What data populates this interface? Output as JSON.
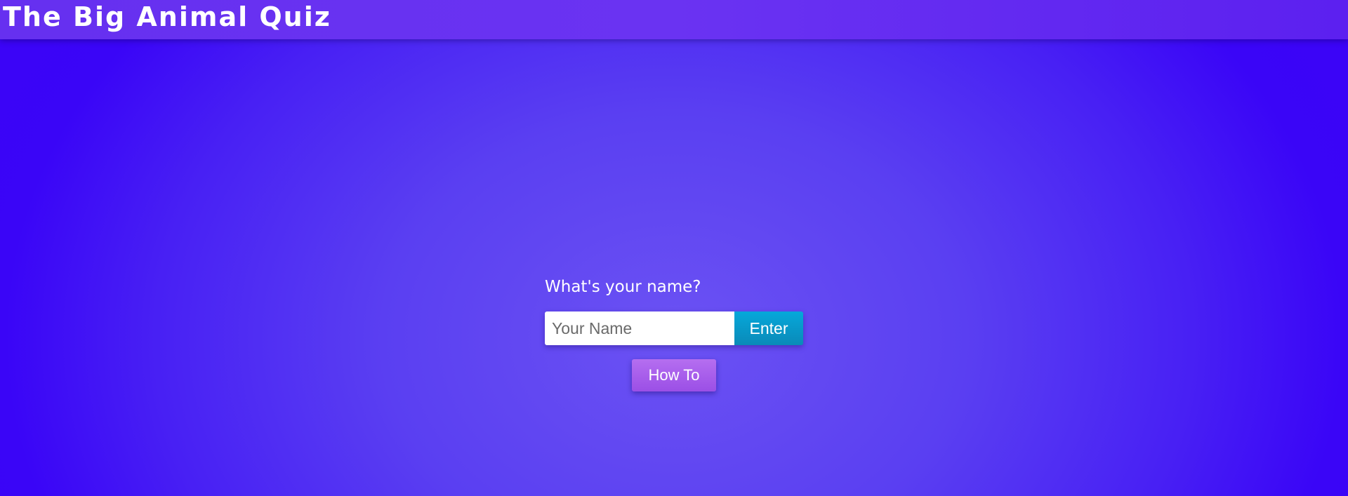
{
  "app": {
    "title": "The Big Animal Quiz"
  },
  "name_form": {
    "prompt": "What's your name?",
    "input_placeholder": "Your Name",
    "input_value": "",
    "enter_label": "Enter"
  },
  "howto": {
    "label": "How To"
  },
  "colors": {
    "background_center": "#6b52f3",
    "background_edge": "#3c03f7",
    "topbar": "#6a33f2",
    "enter_button": "#0a9ac8",
    "howto_button": "#a85fea"
  }
}
